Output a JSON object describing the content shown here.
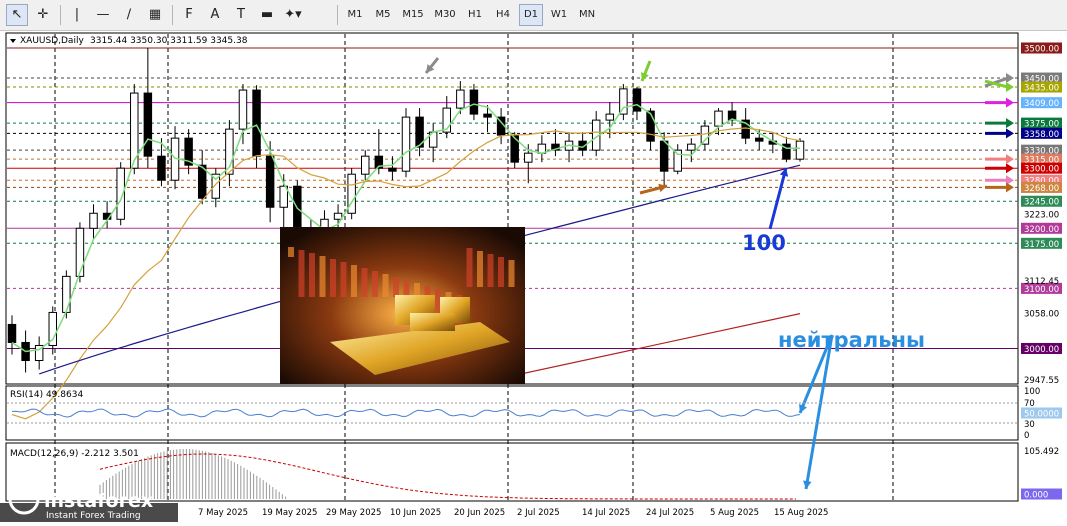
{
  "toolbar": {
    "tools": [
      {
        "name": "cursor-icon",
        "glyph": "↖"
      },
      {
        "name": "crosshair-icon",
        "glyph": "✛"
      },
      {
        "name": "vertical-line-icon",
        "glyph": "|"
      },
      {
        "name": "horizontal-line-icon",
        "glyph": "—"
      },
      {
        "name": "trendline-icon",
        "glyph": "∕"
      },
      {
        "name": "channel-icon",
        "glyph": "▦"
      },
      {
        "name": "fibonacci-icon",
        "glyph": "F"
      },
      {
        "name": "text-icon",
        "glyph": "A"
      },
      {
        "name": "text-label-icon",
        "glyph": "T"
      },
      {
        "name": "rectangle-icon",
        "glyph": "▬"
      },
      {
        "name": "shapes-dropdown-icon",
        "glyph": "✦▾"
      }
    ],
    "timeframes": [
      "M1",
      "M5",
      "M15",
      "M30",
      "H1",
      "H4",
      "D1",
      "W1",
      "MN"
    ],
    "active_timeframe": "D1"
  },
  "header": {
    "symbol": "XAUUSD,Daily",
    "ohlc": "3315.44 3350.30 3311.59 3345.38"
  },
  "price_labels": [
    {
      "text": "3500.00",
      "price": 3500,
      "color": "#8b1a1a"
    },
    {
      "text": "3450.00",
      "price": 3450,
      "color": "#7a7a7a"
    },
    {
      "text": "3435.00",
      "price": 3435,
      "color": "#a6a600"
    },
    {
      "text": "3409.00",
      "price": 3409,
      "color": "#66b3ff"
    },
    {
      "text": "3375.00",
      "price": 3375,
      "color": "#0a7a3c"
    },
    {
      "text": "3358.00",
      "price": 3358,
      "color": "#00008b"
    },
    {
      "text": "3330.00",
      "price": 3330,
      "color": "#777777"
    },
    {
      "text": "3315.00",
      "price": 3315,
      "color": "#e07a5f"
    },
    {
      "text": "3300.00",
      "price": 3300,
      "color": "#cc0000"
    },
    {
      "text": "3280.00",
      "price": 3280,
      "color": "#f08080"
    },
    {
      "text": "3268.00",
      "price": 3268,
      "color": "#cd853f"
    },
    {
      "text": "3245.00",
      "price": 3245,
      "color": "#2e8b57"
    },
    {
      "text": "3200.00",
      "price": 3200,
      "color": "#b0399a"
    },
    {
      "text": "3175.00",
      "price": 3175,
      "color": "#2e8b57"
    },
    {
      "text": "3100.00",
      "price": 3100,
      "color": "#b0399a"
    },
    {
      "text": "3000.00",
      "price": 3000,
      "color": "#660066"
    },
    {
      "text": "0.000",
      "price": null,
      "color": "#7b68ee"
    }
  ],
  "axis_ticks": [
    "3223.00",
    "3112.45",
    "3058.00",
    "2947.55"
  ],
  "horizontal_lines": [
    {
      "price": 3500,
      "color": "#8b1a1a",
      "dash": false
    },
    {
      "price": 3450,
      "color": "#444444",
      "dash": true
    },
    {
      "price": 3435,
      "color": "#8a8a00",
      "dash": true
    },
    {
      "price": 3409,
      "color": "#cc00cc",
      "dash": false
    },
    {
      "price": 3375,
      "color": "#0a7a3c",
      "dash": true
    },
    {
      "price": 3358,
      "color": "#000000",
      "dash": true
    },
    {
      "price": 3330,
      "color": "#444444",
      "dash": true
    },
    {
      "price": 3315,
      "color": "#b87333",
      "dash": true
    },
    {
      "price": 3300,
      "color": "#cc0000",
      "dash": false
    },
    {
      "price": 3280,
      "color": "#d2691e",
      "dash": true
    },
    {
      "price": 3268,
      "color": "#8b4513",
      "dash": true
    },
    {
      "price": 3245,
      "color": "#0a7a3c",
      "dash": true
    },
    {
      "price": 3200,
      "color": "#b0399a",
      "dash": false
    },
    {
      "price": 3175,
      "color": "#0a7a3c",
      "dash": true
    },
    {
      "price": 3100,
      "color": "#b0399a",
      "dash": true
    },
    {
      "price": 3000,
      "color": "#660066",
      "dash": false
    }
  ],
  "annotations": {
    "ma_label": "100",
    "neutral_label": "нейтральны"
  },
  "rsi": {
    "label": "RSI(14) 49.8634",
    "levels": [
      "100",
      "70",
      "30",
      "0"
    ],
    "value_label": "50.0000"
  },
  "macd": {
    "label": "MACD(12,26,9) -2.212 3.501",
    "top_label": "105.492"
  },
  "date_labels": [
    "7 May 2025",
    "19 May 2025",
    "29 May 2025",
    "10 Jun 2025",
    "20 Jun 2025",
    "2 Jul 2025",
    "14 Jul 2025",
    "24 Jul 2025",
    "5 Aug 2025",
    "15 Aug 2025"
  ],
  "watermark": {
    "brand": "instaforex",
    "tagline": "Instant Forex Trading"
  },
  "colors": {
    "bull": "#ffffff",
    "bear": "#000000",
    "ma_fast": "#7ddc7d",
    "ma_mid": "#d4a23c",
    "ma_slow": "#1a1a8c",
    "ma_long": "#b22222",
    "annotation_blue": "#1a3ad6",
    "neutral_blue": "#2a8fe0"
  },
  "chart_data": {
    "type": "candlestick",
    "symbol": "XAUUSD",
    "timeframe": "Daily",
    "candles": [
      [
        3040,
        3055,
        2990,
        3010
      ],
      [
        3010,
        3030,
        2960,
        2980
      ],
      [
        2980,
        3020,
        2965,
        3005
      ],
      [
        3005,
        3070,
        2990,
        3060
      ],
      [
        3060,
        3130,
        3050,
        3120
      ],
      [
        3120,
        3210,
        3110,
        3200
      ],
      [
        3200,
        3240,
        3180,
        3225
      ],
      [
        3225,
        3245,
        3200,
        3215
      ],
      [
        3215,
        3310,
        3205,
        3300
      ],
      [
        3300,
        3440,
        3290,
        3425
      ],
      [
        3425,
        3500,
        3300,
        3320
      ],
      [
        3320,
        3350,
        3270,
        3280
      ],
      [
        3280,
        3370,
        3265,
        3350
      ],
      [
        3350,
        3365,
        3290,
        3305
      ],
      [
        3305,
        3330,
        3240,
        3250
      ],
      [
        3250,
        3300,
        3235,
        3290
      ],
      [
        3290,
        3380,
        3270,
        3365
      ],
      [
        3365,
        3440,
        3340,
        3430
      ],
      [
        3430,
        3438,
        3300,
        3320
      ],
      [
        3320,
        3345,
        3210,
        3235
      ],
      [
        3235,
        3290,
        3200,
        3270
      ],
      [
        3270,
        3280,
        3180,
        3195
      ],
      [
        3195,
        3215,
        3160,
        3180
      ],
      [
        3180,
        3230,
        3140,
        3215
      ],
      [
        3215,
        3240,
        3195,
        3225
      ],
      [
        3225,
        3300,
        3215,
        3290
      ],
      [
        3290,
        3330,
        3280,
        3320
      ],
      [
        3320,
        3365,
        3290,
        3300
      ],
      [
        3300,
        3320,
        3280,
        3295
      ],
      [
        3295,
        3400,
        3285,
        3385
      ],
      [
        3385,
        3400,
        3320,
        3335
      ],
      [
        3335,
        3375,
        3310,
        3360
      ],
      [
        3360,
        3420,
        3350,
        3400
      ],
      [
        3400,
        3445,
        3390,
        3430
      ],
      [
        3430,
        3440,
        3380,
        3390
      ],
      [
        3390,
        3405,
        3360,
        3385
      ],
      [
        3385,
        3400,
        3340,
        3355
      ],
      [
        3355,
        3360,
        3300,
        3310
      ],
      [
        3310,
        3340,
        3275,
        3325
      ],
      [
        3325,
        3355,
        3310,
        3340
      ],
      [
        3340,
        3365,
        3320,
        3330
      ],
      [
        3330,
        3360,
        3310,
        3345
      ],
      [
        3345,
        3360,
        3320,
        3330
      ],
      [
        3330,
        3395,
        3320,
        3380
      ],
      [
        3380,
        3410,
        3350,
        3390
      ],
      [
        3390,
        3440,
        3380,
        3432
      ],
      [
        3432,
        3435,
        3380,
        3395
      ],
      [
        3395,
        3400,
        3330,
        3345
      ],
      [
        3345,
        3360,
        3270,
        3295
      ],
      [
        3295,
        3340,
        3290,
        3330
      ],
      [
        3330,
        3350,
        3310,
        3340
      ],
      [
        3340,
        3380,
        3330,
        3370
      ],
      [
        3370,
        3400,
        3355,
        3395
      ],
      [
        3395,
        3410,
        3370,
        3380
      ],
      [
        3380,
        3400,
        3340,
        3350
      ],
      [
        3350,
        3365,
        3330,
        3345
      ],
      [
        3345,
        3360,
        3325,
        3340
      ],
      [
        3340,
        3352,
        3310,
        3315
      ],
      [
        3315,
        3350,
        3311,
        3345
      ]
    ],
    "horizontal_levels": [
      3500,
      3450,
      3435,
      3409,
      3375,
      3358,
      3330,
      3315,
      3300,
      3280,
      3268,
      3245,
      3200,
      3175,
      3100,
      3000
    ],
    "rsi_value": 49.8634,
    "macd_main": -2.212,
    "macd_signal": 3.501,
    "macd_max": 105.492,
    "ylim": [
      2947.55,
      3500
    ]
  }
}
